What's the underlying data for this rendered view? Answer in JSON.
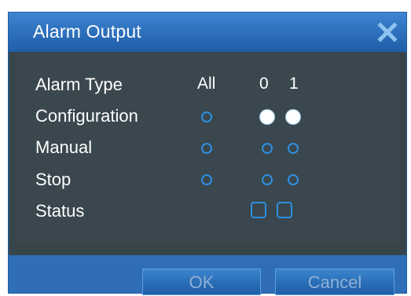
{
  "window": {
    "title": "Alarm Output",
    "close_icon": "close-x-icon"
  },
  "table": {
    "header_label": "Alarm Type",
    "columns": [
      "All",
      "0",
      "1"
    ],
    "rows": [
      {
        "label": "Configuration",
        "all": false,
        "ch0": true,
        "ch1": true
      },
      {
        "label": "Manual",
        "all": false,
        "ch0": false,
        "ch1": false
      },
      {
        "label": "Stop",
        "all": false,
        "ch0": false,
        "ch1": false
      }
    ],
    "status_label": "Status"
  },
  "buttons": {
    "ok_label": "OK",
    "cancel_label": "Cancel"
  },
  "colors": {
    "title_bar": "#2f72be",
    "panel_bg": "#37454b",
    "accent": "#2f8fe0"
  }
}
